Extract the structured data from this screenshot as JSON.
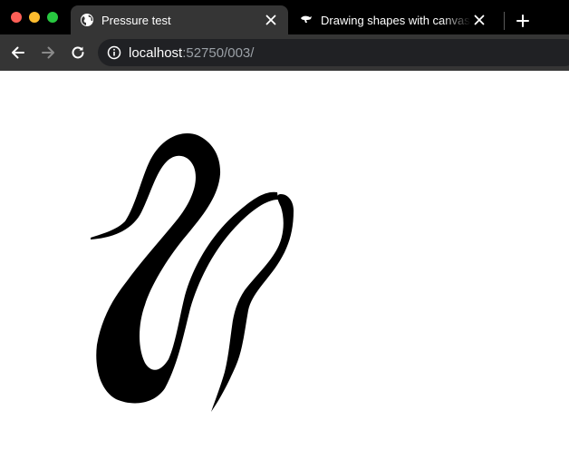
{
  "window": {
    "traffic_lights": [
      "close",
      "minimize",
      "zoom"
    ]
  },
  "tabs": [
    {
      "label": "Pressure test",
      "icon": "globe-icon",
      "active": true
    },
    {
      "label": "Drawing shapes with canvas - Web APIs | MDN",
      "icon": "mdn-dino-icon",
      "active": false
    }
  ],
  "toolbar": {
    "back_icon": "back-arrow-icon",
    "forward_icon": "forward-arrow-icon",
    "reload_icon": "reload-icon",
    "url_host": "localhost",
    "url_path": ":52750/003/",
    "info_icon": "info-icon"
  },
  "colors": {
    "tabstrip_bg": "#000000",
    "toolbar_bg": "#353535",
    "omnibox_bg": "#202124",
    "url_muted": "#9aa0a6",
    "ink": "#000000"
  },
  "canvas": {
    "description_stroke_color": "#000000"
  }
}
